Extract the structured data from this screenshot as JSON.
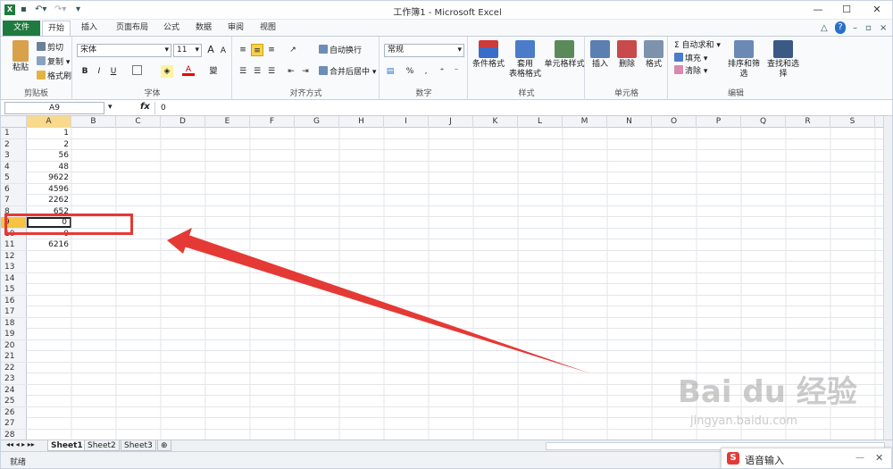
{
  "window": {
    "title": "工作簿1 - Microsoft Excel",
    "minimize": "—",
    "maximize": "☐",
    "close": "✕"
  },
  "tabs": [
    "文件",
    "开始",
    "插入",
    "页面布局",
    "公式",
    "数据",
    "审阅",
    "视图"
  ],
  "ribbon": {
    "clipboard": {
      "label": "剪贴板",
      "paste": "粘贴",
      "cut": "剪切",
      "copy": "复制 ▾",
      "format_painter": "格式刷"
    },
    "font": {
      "label": "字体",
      "font_name": "宋体",
      "font_size": "11",
      "bold": "B",
      "italic": "I",
      "underline": "U",
      "grow": "A",
      "shrink": "A",
      "phonetic": "變"
    },
    "alignment": {
      "label": "对齐方式",
      "wrap": "自动换行",
      "merge": "合并后居中 ▾"
    },
    "number": {
      "label": "数字",
      "format": "常规",
      "percent": "%",
      "comma": ","
    },
    "styles": {
      "label": "样式",
      "cond": "条件格式",
      "table_fmt1": "套用",
      "table_fmt2": "表格格式",
      "cell_style": "单元格样式"
    },
    "cells": {
      "label": "单元格",
      "insert": "插入",
      "delete": "删除",
      "format": "格式"
    },
    "editing": {
      "label": "编辑",
      "autosum": "Σ 自动求和 ▾",
      "fill": "填充 ▾",
      "clear": "清除 ▾",
      "sort": "排序和筛选",
      "find": "查找和选择"
    }
  },
  "formula_bar": {
    "name_box": "A9",
    "fx": "fx",
    "value": "0"
  },
  "columns": [
    "A",
    "B",
    "C",
    "D",
    "E",
    "F",
    "G",
    "H",
    "I",
    "J",
    "K",
    "L",
    "M",
    "N",
    "O",
    "P",
    "Q",
    "R",
    "S"
  ],
  "rows": [
    {
      "n": "1",
      "a": "1"
    },
    {
      "n": "2",
      "a": "2"
    },
    {
      "n": "3",
      "a": "56"
    },
    {
      "n": "4",
      "a": "48"
    },
    {
      "n": "5",
      "a": "9622"
    },
    {
      "n": "6",
      "a": "4596"
    },
    {
      "n": "7",
      "a": "2262"
    },
    {
      "n": "8",
      "a": "652"
    },
    {
      "n": "9",
      "a": "0"
    },
    {
      "n": "10",
      "a": "0"
    },
    {
      "n": "11",
      "a": "6216"
    },
    {
      "n": "12",
      "a": ""
    },
    {
      "n": "13",
      "a": ""
    },
    {
      "n": "14",
      "a": ""
    },
    {
      "n": "15",
      "a": ""
    },
    {
      "n": "16",
      "a": ""
    },
    {
      "n": "17",
      "a": ""
    },
    {
      "n": "18",
      "a": ""
    },
    {
      "n": "19",
      "a": ""
    },
    {
      "n": "20",
      "a": ""
    },
    {
      "n": "21",
      "a": ""
    },
    {
      "n": "22",
      "a": ""
    },
    {
      "n": "23",
      "a": ""
    },
    {
      "n": "24",
      "a": ""
    },
    {
      "n": "25",
      "a": ""
    },
    {
      "n": "26",
      "a": ""
    },
    {
      "n": "27",
      "a": ""
    },
    {
      "n": "28",
      "a": ""
    }
  ],
  "sheets": [
    "Sheet1",
    "Sheet2",
    "Sheet3"
  ],
  "status": "就绪",
  "voice_input": {
    "label": "语音输入",
    "icon_letter": "S"
  },
  "watermark": {
    "brand": "Bai du 经验",
    "url": "jingyan.baidu.com"
  },
  "colors": {
    "file_tab": "#1f7a3f",
    "highlight": "#e53935",
    "selected_row": "#f6c342"
  }
}
